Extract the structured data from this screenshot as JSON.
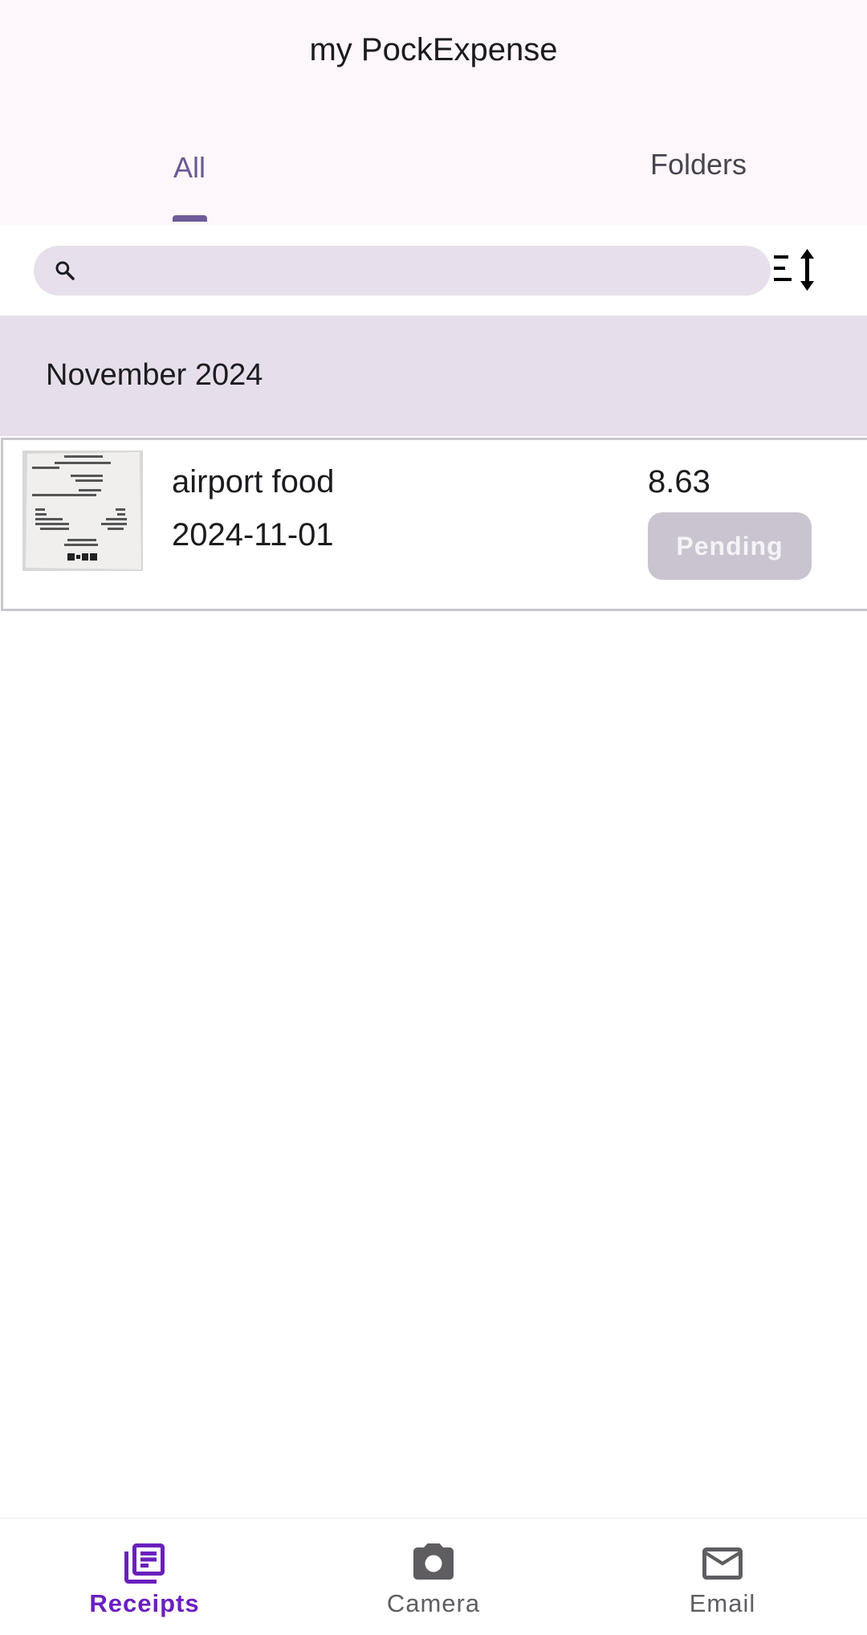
{
  "app": {
    "title": "my PockExpense"
  },
  "tabs": [
    {
      "label": "All",
      "selected": true
    },
    {
      "label": "Folders",
      "selected": false
    }
  ],
  "search": {
    "placeholder": "",
    "value": ""
  },
  "sections": [
    {
      "title": "November 2024",
      "receipts": [
        {
          "name": "airport food",
          "date": "2024-11-01",
          "amount": "8.63",
          "status": "Pending"
        }
      ]
    }
  ],
  "bottom_nav": [
    {
      "label": "Receipts",
      "icon": "receipts-icon",
      "active": true
    },
    {
      "label": "Camera",
      "icon": "camera-icon",
      "active": false
    },
    {
      "label": "Email",
      "icon": "email-icon",
      "active": false
    }
  ],
  "colors": {
    "accent": "#6b1fbf",
    "tab_indicator": "#6e5b9a",
    "header_bg": "#fdf7fc",
    "section_bg": "#e6dfeb",
    "status_badge": "#cac4d0"
  }
}
